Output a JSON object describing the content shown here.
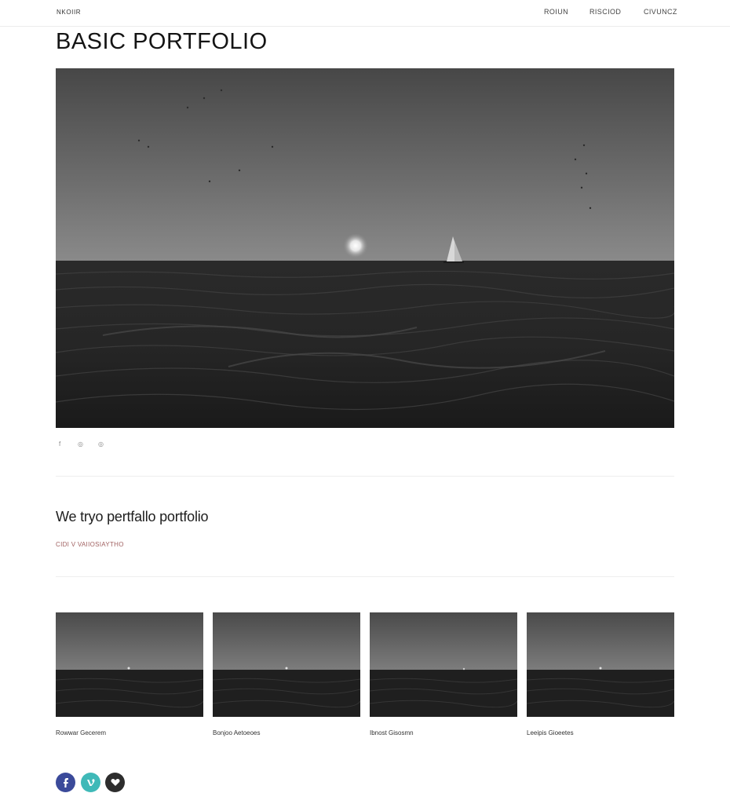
{
  "header": {
    "brand": "NKOIIR",
    "nav": [
      "ROIUN",
      "RISCIOD",
      "CIVUNCZ"
    ]
  },
  "page_title": "BASIC PORTFOLIO",
  "hero_icons": [
    "f",
    "◎",
    "◎"
  ],
  "section": {
    "heading": "We tryo pertfallo portfolio",
    "subtitle": "CIDI V VAIIOSIAYTHO"
  },
  "gallery": {
    "captions": [
      "Rowwar Gecerem",
      "Bonjoo Aetoeoes",
      "Ibnost Gisosmn",
      "Leeipis Gioeetes"
    ]
  },
  "footer": {
    "social_icons": [
      "facebook-icon",
      "vine-icon",
      "heart-icon"
    ]
  },
  "colors": {
    "facebook": "#3b4a9a",
    "vine": "#3fb9b8",
    "dark": "#2d2d2d",
    "subtitle_accent": "#a06060"
  }
}
